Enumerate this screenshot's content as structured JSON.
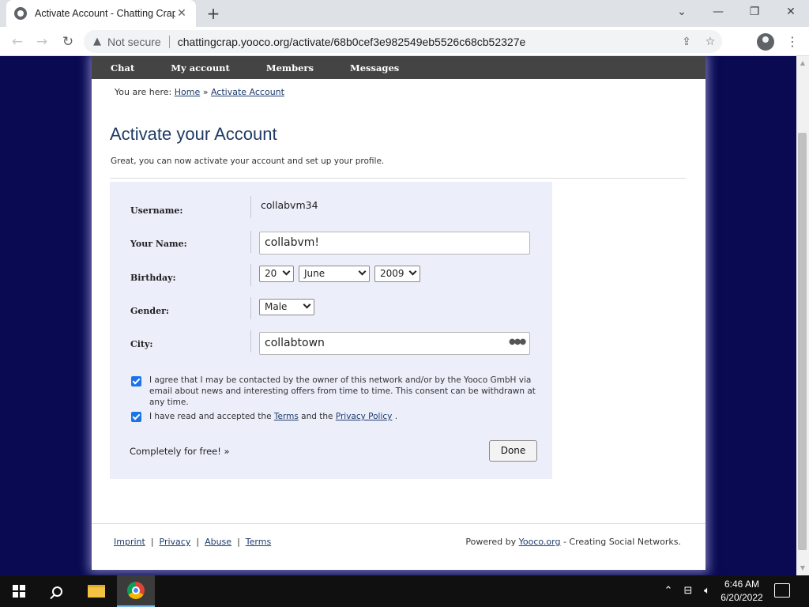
{
  "browser": {
    "tab_title": "Activate Account - Chatting Crap",
    "tab_close": "✕",
    "new_tab": "+",
    "security_label": "Not secure",
    "url": "chattingcrap.yooco.org/activate/68b0cef3e982549eb5526c68cb52327e"
  },
  "nav": {
    "items": [
      "Chat",
      "My account",
      "Members",
      "Messages"
    ]
  },
  "breadcrumb": {
    "prefix": "You are here:",
    "home": "Home",
    "separator": "»",
    "current": "Activate Account"
  },
  "page": {
    "title": "Activate your Account",
    "subtitle": "Great, you can now activate your account and set up your profile."
  },
  "form": {
    "username_label": "Username:",
    "username_value": "collabvm34",
    "name_label": "Your Name:",
    "name_value": "collabvm!",
    "birthday_label": "Birthday:",
    "birthday_day": "20",
    "birthday_month": "June",
    "birthday_year": "2009",
    "gender_label": "Gender:",
    "gender_value": "Male",
    "city_label": "City:",
    "city_value": "collabtown",
    "consent_text": "I agree that I may be contacted by the owner of this network and/or by the Yooco GmbH via email about news and interesting offers from time to time. This consent can be withdrawn at any time.",
    "consent_checked": true,
    "terms_prefix": "I have read and accepted the",
    "terms_link": "Terms",
    "terms_and": "and the",
    "privacy_link": "Privacy Policy",
    "terms_suffix": ".",
    "terms_checked": true,
    "free_text": "Completely for free! »",
    "done_label": "Done"
  },
  "footer": {
    "links": [
      "Imprint",
      "Privacy",
      "Abuse",
      "Terms"
    ],
    "powered_prefix": "Powered by",
    "powered_link": "Yooco.org",
    "powered_suffix": "- Creating Social Networks."
  },
  "taskbar": {
    "time": "6:46 AM",
    "date": "6/20/2022"
  },
  "colors": {
    "page_background": "#0a0a52",
    "nav_background": "#444444",
    "title_color": "#1f3b63",
    "form_panel": "#eceefa",
    "checkbox_accent": "#1a73e8"
  }
}
